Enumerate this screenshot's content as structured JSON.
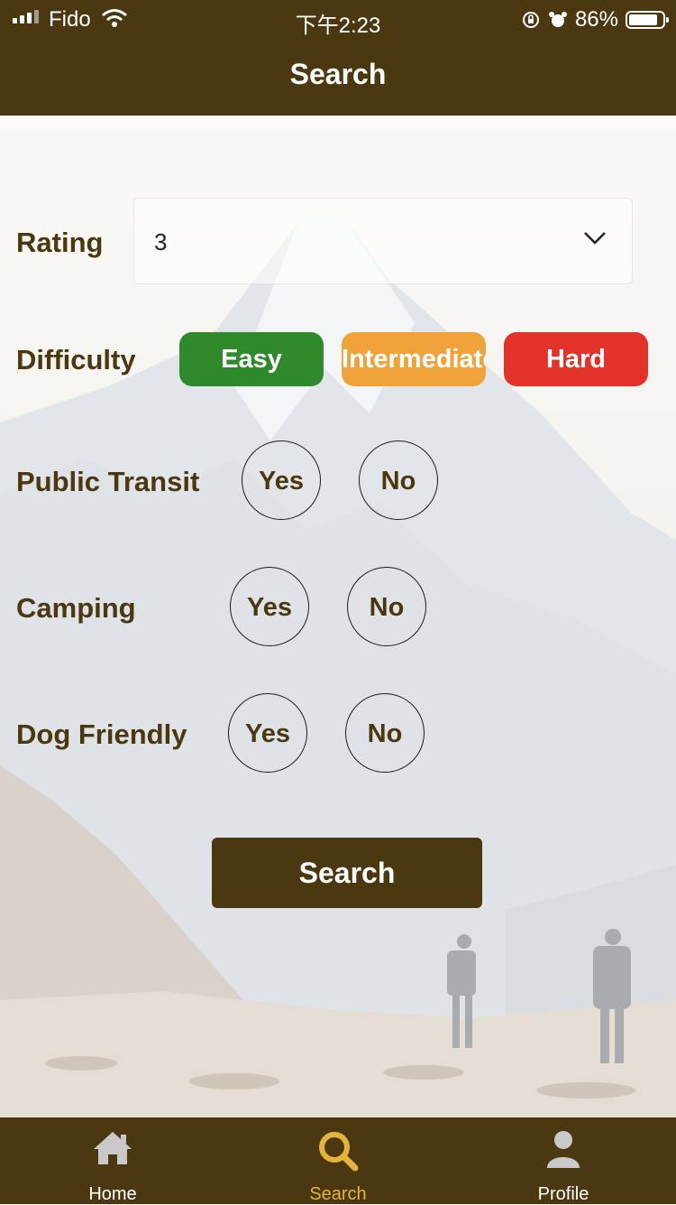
{
  "status_bar": {
    "carrier": "Fido",
    "time": "下午2:23",
    "battery": "86%",
    "battery_level": 0.86
  },
  "header": {
    "title": "Search"
  },
  "form": {
    "rating": {
      "label": "Rating",
      "value": "3"
    },
    "difficulty": {
      "label": "Difficulty",
      "options": [
        {
          "label": "Easy",
          "color": "#2f8a2b"
        },
        {
          "label": "Intermediate",
          "color": "#efa33a"
        },
        {
          "label": "Hard",
          "color": "#e3322a"
        }
      ]
    },
    "public_transit": {
      "label": "Public Transit",
      "yes": "Yes",
      "no": "No"
    },
    "camping": {
      "label": "Camping",
      "yes": "Yes",
      "no": "No"
    },
    "dog_friendly": {
      "label": "Dog Friendly",
      "yes": "Yes",
      "no": "No"
    },
    "search_button": "Search"
  },
  "tab_bar": {
    "items": [
      {
        "label": "Home",
        "icon": "home-icon",
        "active": false
      },
      {
        "label": "Search",
        "icon": "search-icon",
        "active": true
      },
      {
        "label": "Profile",
        "icon": "profile-icon",
        "active": false
      }
    ],
    "active_color": "#e3b43d"
  },
  "colors": {
    "brand": "#4b3810"
  }
}
